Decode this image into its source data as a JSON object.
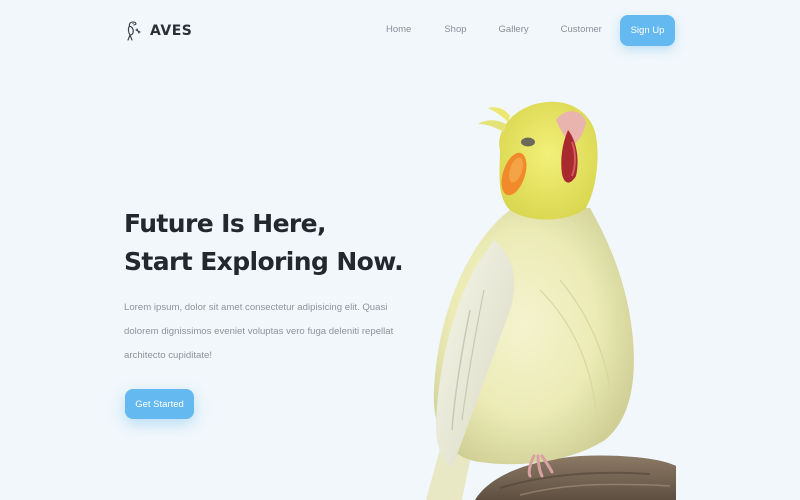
{
  "brand": {
    "name": "AVES",
    "icon": "bird-logo-icon"
  },
  "nav": {
    "items": [
      {
        "label": "Home"
      },
      {
        "label": "Shop"
      },
      {
        "label": "Gallery"
      },
      {
        "label": "Customer"
      }
    ],
    "signup_label": "Sign Up"
  },
  "hero": {
    "title_line1": "Future Is Here,",
    "title_line2": "Start Exploring Now.",
    "description": "Lorem ipsum, dolor sit amet consectetur adipisicing elit. Quasi dolorem dignissimos eveniet voluptas vero fuga deleniti repellat architecto cupiditate!",
    "cta_label": "Get Started"
  },
  "colors": {
    "background": "#f1f7fb",
    "accent": "#64b9f0",
    "heading": "#23272e",
    "muted": "#8e939b"
  }
}
